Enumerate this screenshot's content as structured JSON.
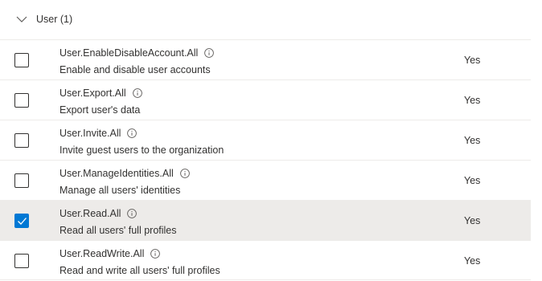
{
  "group": {
    "title": "User (1)",
    "expanded": true
  },
  "permissions": [
    {
      "name": "User.EnableDisableAccount.All",
      "description": "Enable and disable user accounts",
      "admin_consent": "Yes",
      "checked": false
    },
    {
      "name": "User.Export.All",
      "description": "Export user's data",
      "admin_consent": "Yes",
      "checked": false
    },
    {
      "name": "User.Invite.All",
      "description": "Invite guest users to the organization",
      "admin_consent": "Yes",
      "checked": false
    },
    {
      "name": "User.ManageIdentities.All",
      "description": "Manage all users' identities",
      "admin_consent": "Yes",
      "checked": false
    },
    {
      "name": "User.Read.All",
      "description": "Read all users' full profiles",
      "admin_consent": "Yes",
      "checked": true
    },
    {
      "name": "User.ReadWrite.All",
      "description": "Read and write all users' full profiles",
      "admin_consent": "Yes",
      "checked": false
    }
  ],
  "colors": {
    "accent": "#0078d4",
    "selected_row": "#edebe9",
    "text": "#323130"
  },
  "icons": {
    "group_toggle": "chevron-down-icon",
    "info": "info-icon",
    "check": "checkmark-icon"
  }
}
